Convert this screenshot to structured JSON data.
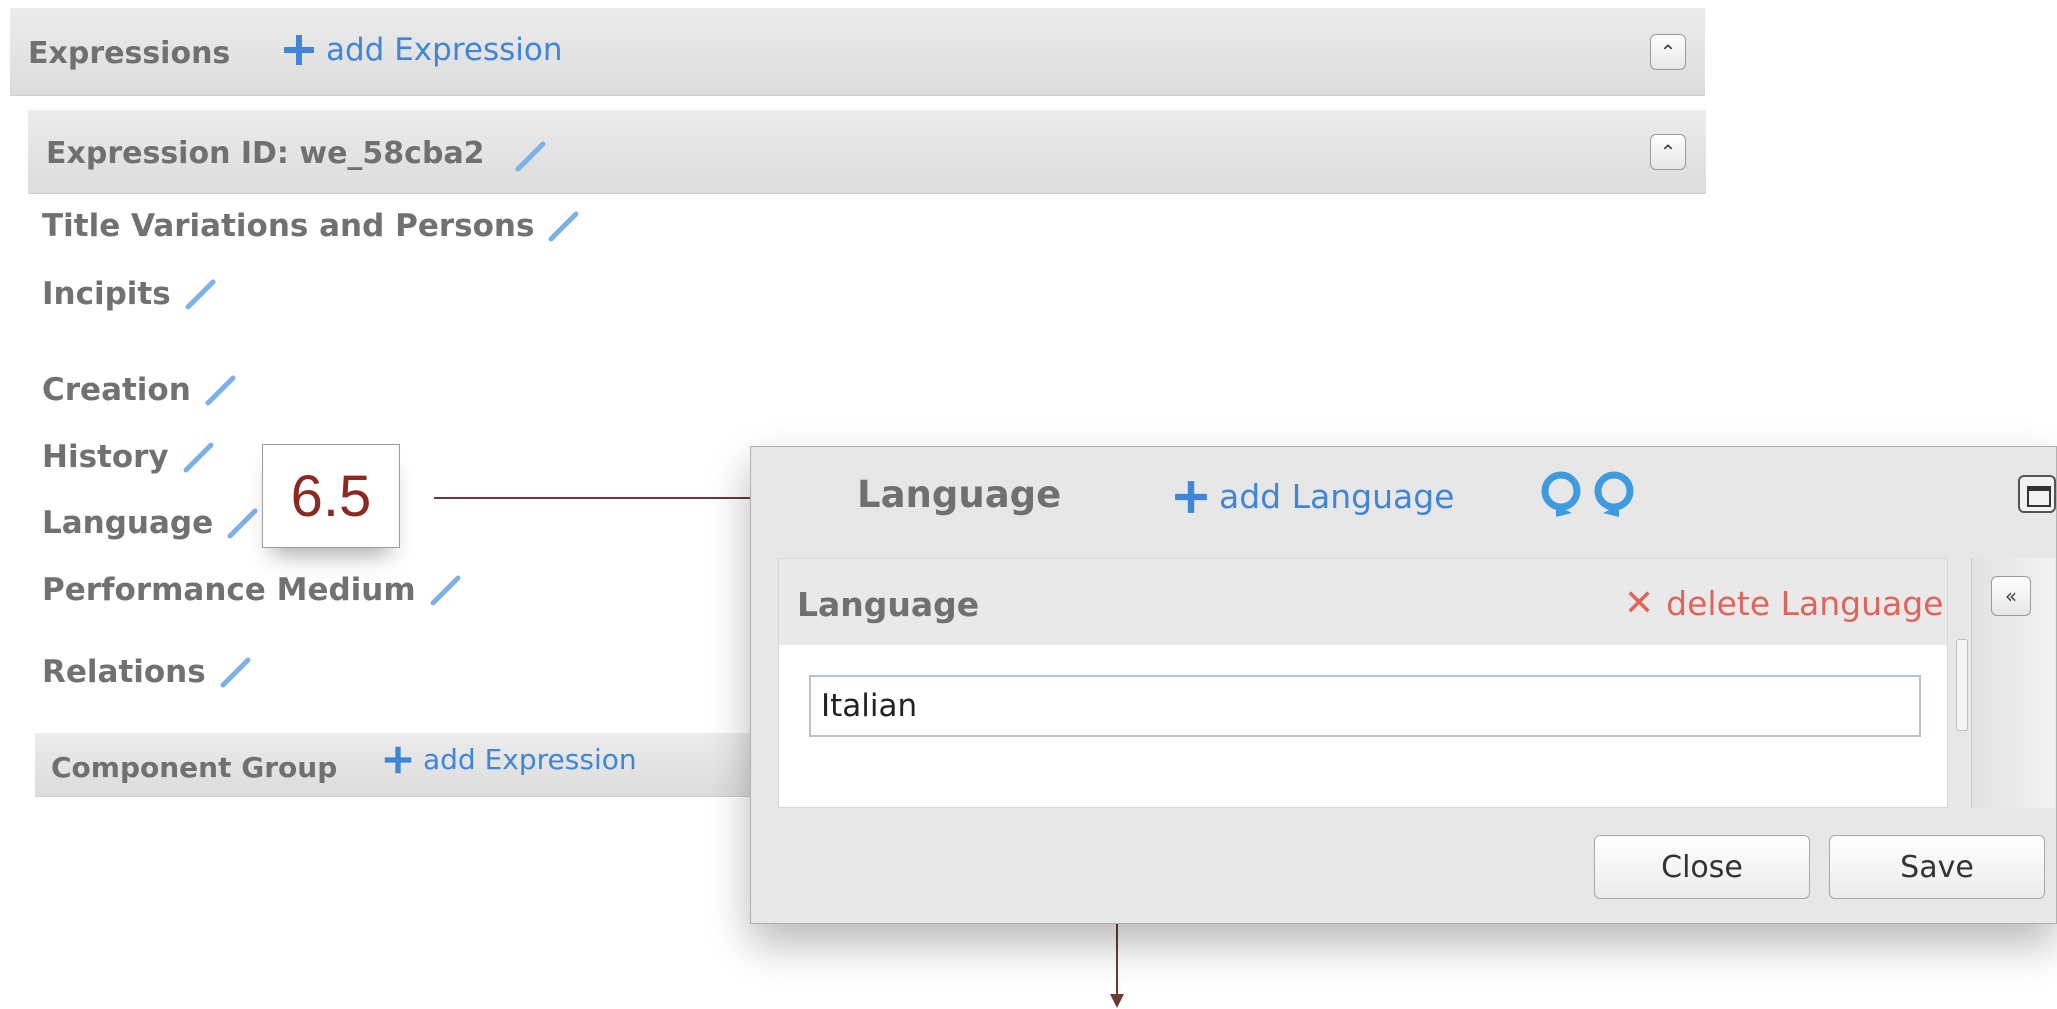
{
  "expressions_header": {
    "title": "Expressions",
    "add_label": "add Expression"
  },
  "expression": {
    "id_label": "Expression ID: we_58cba2"
  },
  "sections": [
    {
      "label": "Title Variations and Persons"
    },
    {
      "label": "Incipits"
    },
    {
      "label": "Creation"
    },
    {
      "label": "History"
    },
    {
      "label": "Language"
    },
    {
      "label": "Performance Medium"
    },
    {
      "label": "Relations"
    }
  ],
  "component_group": {
    "title": "Component Group",
    "add_label": "add Expression"
  },
  "callout": {
    "number": "6.5"
  },
  "dialog": {
    "title": "Language",
    "add_label": "add Language",
    "panel_title": "Language",
    "delete_label": "delete Language",
    "input_value": "Italian",
    "close_label": "Close",
    "save_label": "Save"
  },
  "icons": {
    "pencil": "pencil-icon",
    "plus": "plus-icon",
    "delete": "x-icon",
    "undo": "undo-icon",
    "redo": "redo-icon",
    "collapse": "double-chevron-up-icon",
    "collapse_left": "double-chevron-left-icon",
    "maximize": "maximize-icon"
  },
  "colors": {
    "link_blue": "#3f86d6",
    "delete_red": "#e0645c",
    "annotation_red": "#8b2a22",
    "arrow_brown": "#6b3a34"
  }
}
